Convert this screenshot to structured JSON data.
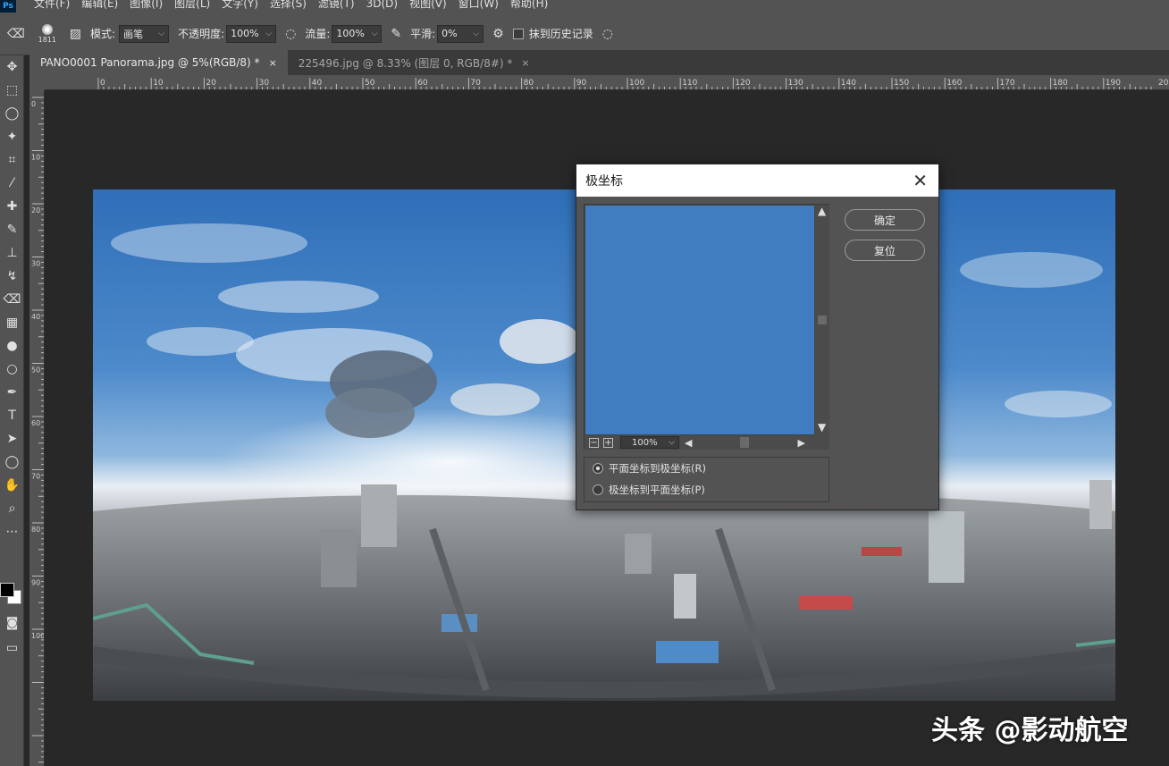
{
  "menu": {
    "logo": "Ps",
    "items": [
      "文件(F)",
      "编辑(E)",
      "图像(I)",
      "图层(L)",
      "文字(Y)",
      "选择(S)",
      "滤镜(T)",
      "3D(D)",
      "视图(V)",
      "窗口(W)",
      "帮助(H)"
    ]
  },
  "options": {
    "brush_size": "1811",
    "mode_label": "模式:",
    "mode_value": "画笔",
    "opacity_label": "不透明度:",
    "opacity_value": "100%",
    "flow_label": "流量:",
    "flow_value": "100%",
    "smooth_label": "平滑:",
    "smooth_value": "0%",
    "erase_history_label": "抹到历史记录"
  },
  "tabs": [
    {
      "label": "PANO0001 Panorama.jpg @ 5%(RGB/8) *",
      "close": "×"
    },
    {
      "label": "225496.jpg @ 8.33% (图层 0, RGB/8#) *",
      "close": "×"
    }
  ],
  "ruler": {
    "h_ticks": [
      "0",
      "10",
      "20",
      "30",
      "40",
      "50",
      "60",
      "70",
      "80",
      "90",
      "100",
      "110",
      "120",
      "130",
      "140",
      "150",
      "160",
      "170",
      "180",
      "190",
      "200"
    ],
    "v_ticks": [
      "0",
      "1 0",
      "2 0",
      "3 0",
      "4 0",
      "5 0",
      "6 0",
      "7 0",
      "8 0",
      "9 0",
      "1 0 0"
    ]
  },
  "dialog": {
    "title": "极坐标",
    "close": "✕",
    "ok_label": "确定",
    "reset_label": "复位",
    "zoom_value": "100%",
    "zoom_minus": "−",
    "zoom_plus": "+",
    "option_rect_to_polar": "平面坐标到极坐标(R)",
    "option_polar_to_rect": "极坐标到平面坐标(P)",
    "selected_option": "rect_to_polar"
  },
  "watermark": {
    "text": "头条 @影动航空"
  },
  "colors": {
    "app_bg": "#282828",
    "panel": "#535353",
    "preview_blue": "#3f7cc0"
  }
}
